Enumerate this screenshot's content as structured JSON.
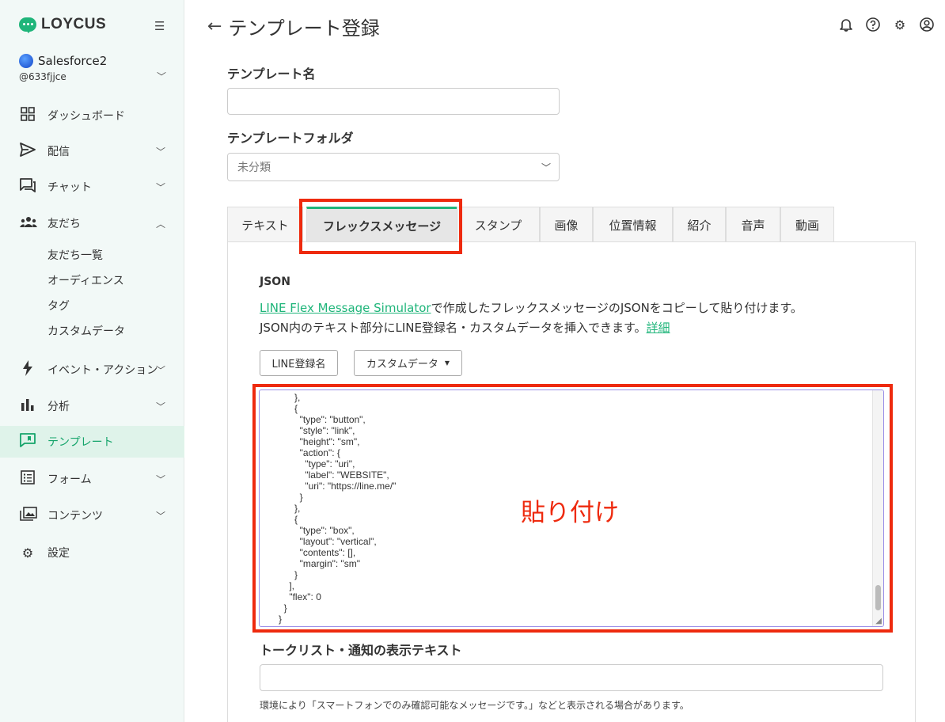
{
  "app": {
    "logo_text": "LOYCUS"
  },
  "account": {
    "name": "Salesforce2",
    "handle": "@633fjjce"
  },
  "nav": {
    "dashboard": "ダッシュボード",
    "delivery": "配信",
    "chat": "チャット",
    "friends": "友だち",
    "friends_sub": [
      "友だち一覧",
      "オーディエンス",
      "タグ",
      "カスタムデータ"
    ],
    "events": "イベント・アクション",
    "analytics": "分析",
    "template": "テンプレート",
    "form": "フォーム",
    "contents": "コンテンツ",
    "settings": "設定"
  },
  "header": {
    "title": "テンプレート登録"
  },
  "form": {
    "template_name_label": "テンプレート名",
    "template_name_value": "",
    "folder_label": "テンプレートフォルダ",
    "folder_value": "未分類"
  },
  "tabs": [
    "テキスト",
    "フレックスメッセージ",
    "スタンプ",
    "画像",
    "位置情報",
    "紹介",
    "音声",
    "動画"
  ],
  "active_tab": "フレックスメッセージ",
  "flex": {
    "json_title": "JSON",
    "simulator_link": "LINE Flex Message Simulator",
    "desc_line1_rest": "で作成したフレックスメッセージのJSONをコピーして貼り付けます。",
    "desc_line2": "JSON内のテキスト部分にLINE登録名・カスタムデータを挿入できます。",
    "detail_link": "詳細",
    "line_name_button": "LINE登録名",
    "custom_data_button": "カスタムデータ",
    "code_lines": [
      "            },",
      "            {",
      "              \"type\": \"button\",",
      "              \"style\": \"link\",",
      "              \"height\": \"sm\",",
      "              \"action\": {",
      "                \"type\": \"uri\",",
      "                \"label\": \"WEBSITE\",",
      "                \"uri\": \"https://line.me/\"",
      "              }",
      "            },",
      "            {",
      "              \"type\": \"box\",",
      "              \"layout\": \"vertical\",",
      "              \"contents\": [],",
      "              \"margin\": \"sm\"",
      "            }",
      "          ],",
      "          \"flex\": 0",
      "        }",
      "      }"
    ],
    "paste_annotation": "貼り付け"
  },
  "alt_text": {
    "label": "トークリスト・通知の表示テキスト",
    "value": "",
    "hint": "環境により「スマートフォンでのみ確認可能なメッセージです。」などと表示される場合があります。"
  },
  "colors": {
    "brand": "#1fb57a",
    "highlight": "#ee2a0e",
    "sidebar_bg": "#f2f9f7"
  }
}
